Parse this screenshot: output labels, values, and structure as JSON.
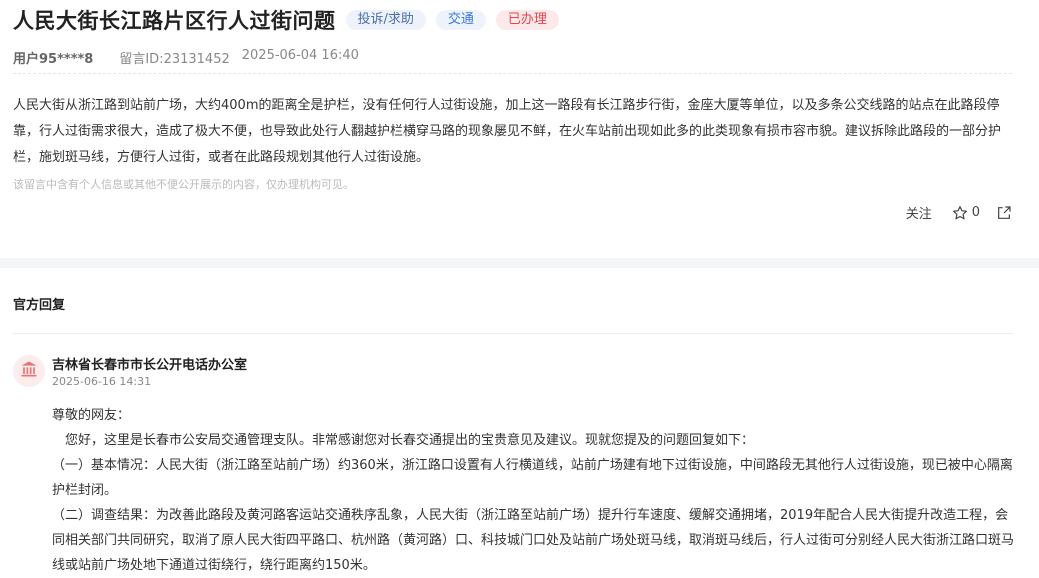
{
  "post": {
    "title": "人民大街长江路片区行人过街问题",
    "tags": {
      "category": "投诉/求助",
      "area": "交通",
      "status": "已办理"
    },
    "user": "用户95****8",
    "message_id": "留言ID:23131452",
    "datetime": "2025-06-04 16:40",
    "content": "人民大街从浙江路到站前广场，大约400m的距离全是护栏，没有任何行人过街设施，加上这一路段有长江路步行街，金座大厦等单位，以及多条公交线路的站点在此路段停靠，行人过街需求很大，造成了极大不便，也导致此处行人翻越护栏横穿马路的现象屡见不鲜，在火车站前出现如此多的此类现象有损市容市貌。建议拆除此路段的一部分护栏，施划斑马线，方便行人过街，或者在此路段规划其他行人过街设施。",
    "notice": "该留言中含有个人信息或其他不便公开展示的内容，仅办理机构可见。"
  },
  "actions": {
    "follow_label": "关注",
    "star_count": "0"
  },
  "reply_section": {
    "title": "官方回复",
    "org_name": "吉林省长春市市长公开电话办公室",
    "datetime": "2025-06-16 14:31",
    "greeting": "尊敬的网友：",
    "para1": "您好，这里是长春市公安局交通管理支队。非常感谢您对长春交通提出的宝贵意见及建议。现就您提及的问题回复如下：",
    "para2": "（一）基本情况：人民大街（浙江路至站前广场）约360米，浙江路口设置有人行横道线，站前广场建有地下过街设施，中间路段无其他行人过街设施，现已被中心隔离护栏封闭。",
    "para3": "（二）调查结果：为改善此路段及黄河路客运站交通秩序乱象，人民大街（浙江路至站前广场）提升行车速度、缓解交通拥堵，2019年配合人民大街提升改造工程，会同相关部门共同研究，取消了原人民大街四平路口、杭州路（黄河路）口、科技城门口处及站前广场处斑马线，取消斑马线后，行人过街可分别经人民大街浙江路口斑马线或站前广场处地下通道过街绕行，绕行距离约150米。"
  },
  "icons": {
    "star": "star-outline-icon",
    "share": "share-icon",
    "org": "government-building-icon"
  },
  "colors": {
    "status_red": "#e0464e",
    "area_blue": "#3a78d8",
    "org_icon": "#e57373"
  }
}
